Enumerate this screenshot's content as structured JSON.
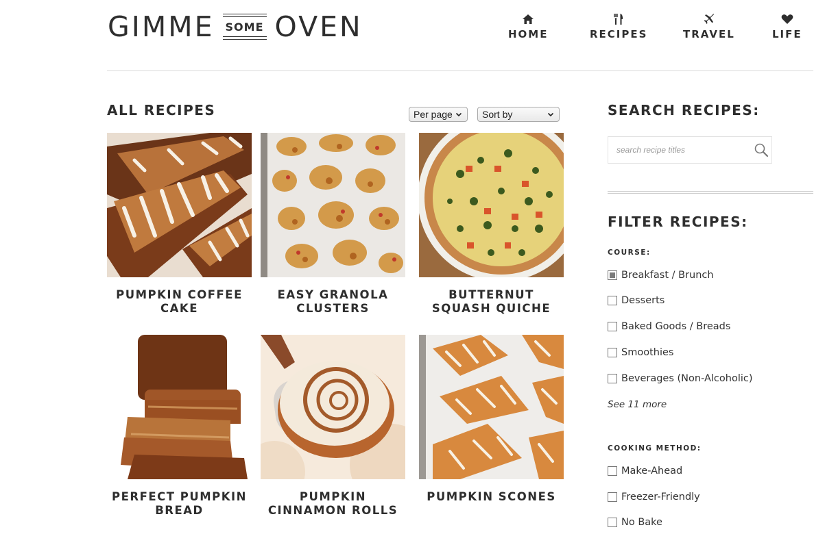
{
  "header": {
    "logo": {
      "word1": "GIMME",
      "word2": "SOME",
      "word3": "OVEN"
    },
    "nav": [
      {
        "label": "HOME",
        "icon": "home-icon"
      },
      {
        "label": "RECIPES",
        "icon": "fork-knife-icon"
      },
      {
        "label": "TRAVEL",
        "icon": "airplane-icon"
      },
      {
        "label": "LIFE",
        "icon": "heart-icon"
      }
    ]
  },
  "main": {
    "title": "ALL RECIPES",
    "per_page_label": "Per page",
    "sort_by_label": "Sort by",
    "recipes": [
      {
        "title": "PUMPKIN COFFEE CAKE"
      },
      {
        "title": "EASY GRANOLA CLUSTERS"
      },
      {
        "title": "BUTTERNUT SQUASH QUICHE"
      },
      {
        "title": "PERFECT PUMPKIN BREAD"
      },
      {
        "title": "PUMPKIN CINNAMON ROLLS"
      },
      {
        "title": "PUMPKIN SCONES"
      }
    ]
  },
  "sidebar": {
    "search_title": "SEARCH RECIPES:",
    "search_placeholder": "search recipe titles",
    "filter_title": "FILTER RECIPES:",
    "course_heading": "COURSE:",
    "course_options": [
      {
        "label": "Breakfast / Brunch",
        "checked": true
      },
      {
        "label": "Desserts",
        "checked": false
      },
      {
        "label": "Baked Goods / Breads",
        "checked": false
      },
      {
        "label": "Smoothies",
        "checked": false
      },
      {
        "label": "Beverages (Non-Alcoholic)",
        "checked": false
      }
    ],
    "see_more": "See 11 more",
    "method_heading": "COOKING METHOD:",
    "method_options": [
      {
        "label": "Make-Ahead",
        "checked": false
      },
      {
        "label": "Freezer-Friendly",
        "checked": false
      },
      {
        "label": "No Bake",
        "checked": false
      }
    ]
  },
  "colors": {
    "text": "#2e2e2e",
    "rule": "#d8d8d8",
    "checkbox_fill": "#7a7a7a"
  }
}
